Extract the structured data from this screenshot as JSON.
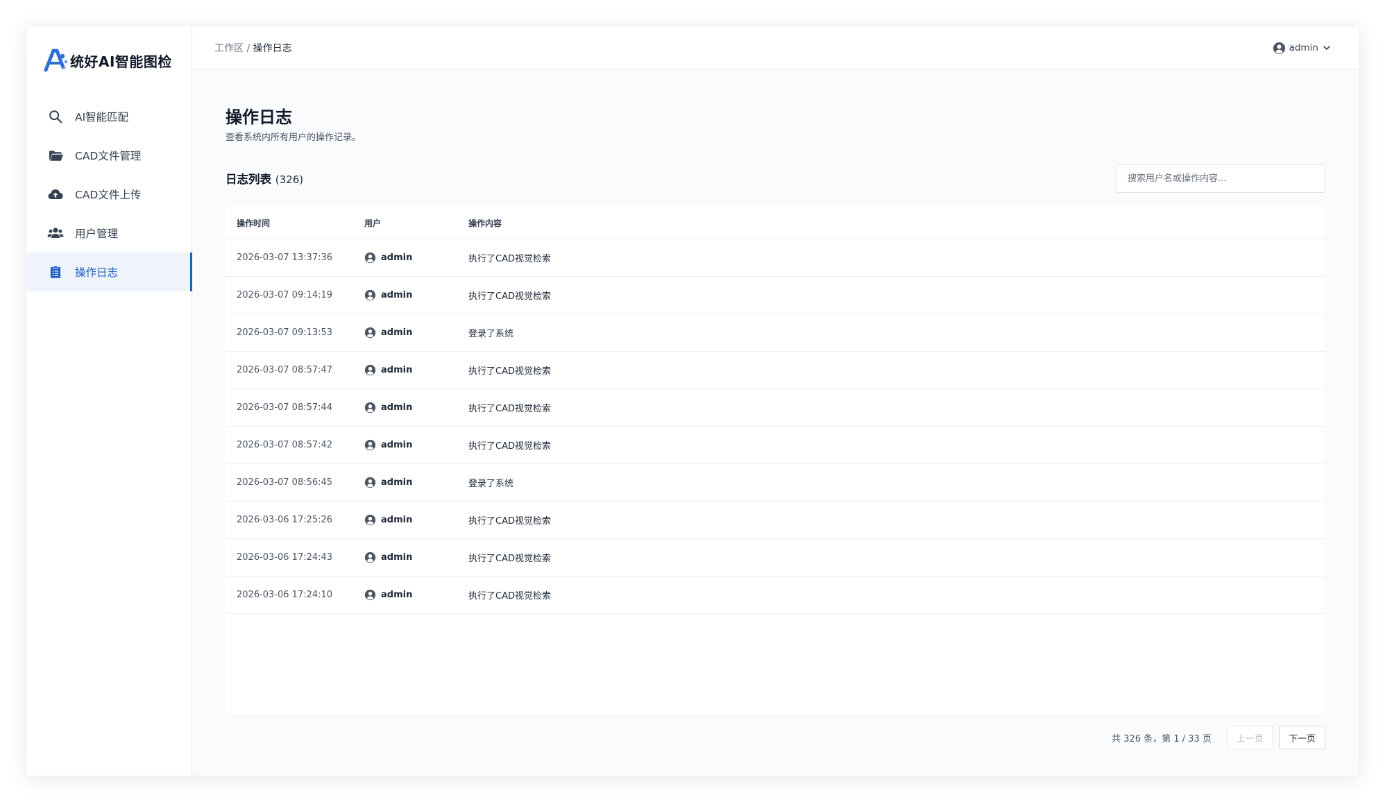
{
  "app": {
    "title": "统好AI智能图检"
  },
  "colors": {
    "accent": "#1f5fbf",
    "sidebar_active_bg": "#eff4fb",
    "page_bg": "#fafbfc"
  },
  "sidebar": {
    "items": [
      {
        "label": "AI智能匹配",
        "icon": "search-icon",
        "active": false
      },
      {
        "label": "CAD文件管理",
        "icon": "folder-open-icon",
        "active": false
      },
      {
        "label": "CAD文件上传",
        "icon": "cloud-upload-icon",
        "active": false
      },
      {
        "label": "用户管理",
        "icon": "users-icon",
        "active": false
      },
      {
        "label": "操作日志",
        "icon": "clipboard-list-icon",
        "active": true
      }
    ]
  },
  "header": {
    "breadcrumb_root": "工作区",
    "breadcrumb_sep": " / ",
    "breadcrumb_current": "操作日志",
    "user_name": "admin"
  },
  "page": {
    "title": "操作日志",
    "description": "查看系统内所有用户的操作记录。"
  },
  "list": {
    "title": "日志列表",
    "count": "(326)",
    "search_placeholder": "搜索用户名或操作内容..."
  },
  "table": {
    "columns": [
      "操作时间",
      "用户",
      "操作内容"
    ],
    "rows": [
      {
        "time": "2026-03-07 13:37:36",
        "user": "admin",
        "action": "执行了CAD视觉检索"
      },
      {
        "time": "2026-03-07 09:14:19",
        "user": "admin",
        "action": "执行了CAD视觉检索"
      },
      {
        "time": "2026-03-07 09:13:53",
        "user": "admin",
        "action": "登录了系统"
      },
      {
        "time": "2026-03-07 08:57:47",
        "user": "admin",
        "action": "执行了CAD视觉检索"
      },
      {
        "time": "2026-03-07 08:57:44",
        "user": "admin",
        "action": "执行了CAD视觉检索"
      },
      {
        "time": "2026-03-07 08:57:42",
        "user": "admin",
        "action": "执行了CAD视觉检索"
      },
      {
        "time": "2026-03-07 08:56:45",
        "user": "admin",
        "action": "登录了系统"
      },
      {
        "time": "2026-03-06 17:25:26",
        "user": "admin",
        "action": "执行了CAD视觉检索"
      },
      {
        "time": "2026-03-06 17:24:43",
        "user": "admin",
        "action": "执行了CAD视觉检索"
      },
      {
        "time": "2026-03-06 17:24:10",
        "user": "admin",
        "action": "执行了CAD视觉检索"
      }
    ]
  },
  "pagination": {
    "info": "共 326 条，第 1 / 33 页",
    "prev_label": "上一页",
    "next_label": "下一页"
  }
}
